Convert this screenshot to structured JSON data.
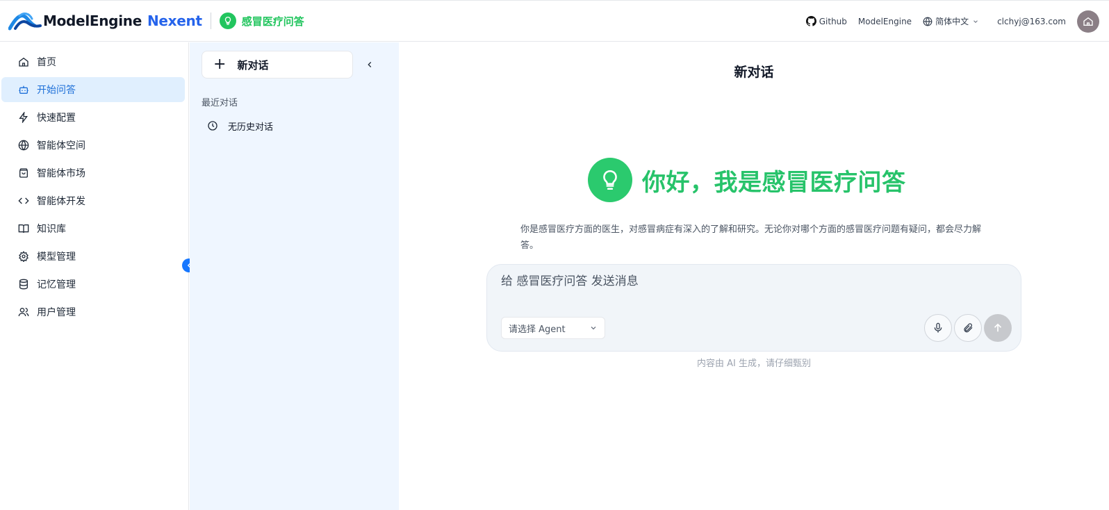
{
  "brand": {
    "name": "ModelEngine",
    "product": "Nexent",
    "app_name": "感冒医疗问答",
    "accent": "#22c55e",
    "primary": "#2563eb"
  },
  "header_links": {
    "github": "Github",
    "modelengine": "ModelEngine",
    "language": "简体中文",
    "user_email": "clchyj@163.com"
  },
  "nav": {
    "items": [
      {
        "label": "首页",
        "icon": "home-icon"
      },
      {
        "label": "开始问答",
        "icon": "bot-icon",
        "active": true
      },
      {
        "label": "快速配置",
        "icon": "zap-icon"
      },
      {
        "label": "智能体空间",
        "icon": "globe-icon"
      },
      {
        "label": "智能体市场",
        "icon": "shopping-bag-icon"
      },
      {
        "label": "智能体开发",
        "icon": "code-icon"
      },
      {
        "label": "知识库",
        "icon": "book-open-icon"
      },
      {
        "label": "模型管理",
        "icon": "gear-icon"
      },
      {
        "label": "记忆管理",
        "icon": "database-icon"
      },
      {
        "label": "用户管理",
        "icon": "users-icon"
      }
    ]
  },
  "conversations": {
    "new_chat_label": "新对话",
    "recent_label": "最近对话",
    "empty_label": "无历史对话"
  },
  "main": {
    "title": "新对话",
    "greeting": "你好，我是感冒医疗问答",
    "description": "你是感冒医疗方面的医生，对感冒病症有深入的了解和研究。无论你对哪个方面的感冒医疗问题有疑问，都会尽力解答。",
    "input_placeholder": "给 感冒医疗问答 发送消息",
    "agent_select_placeholder": "请选择 Agent",
    "footnote": "内容由 AI 生成，请仔细甄别"
  }
}
